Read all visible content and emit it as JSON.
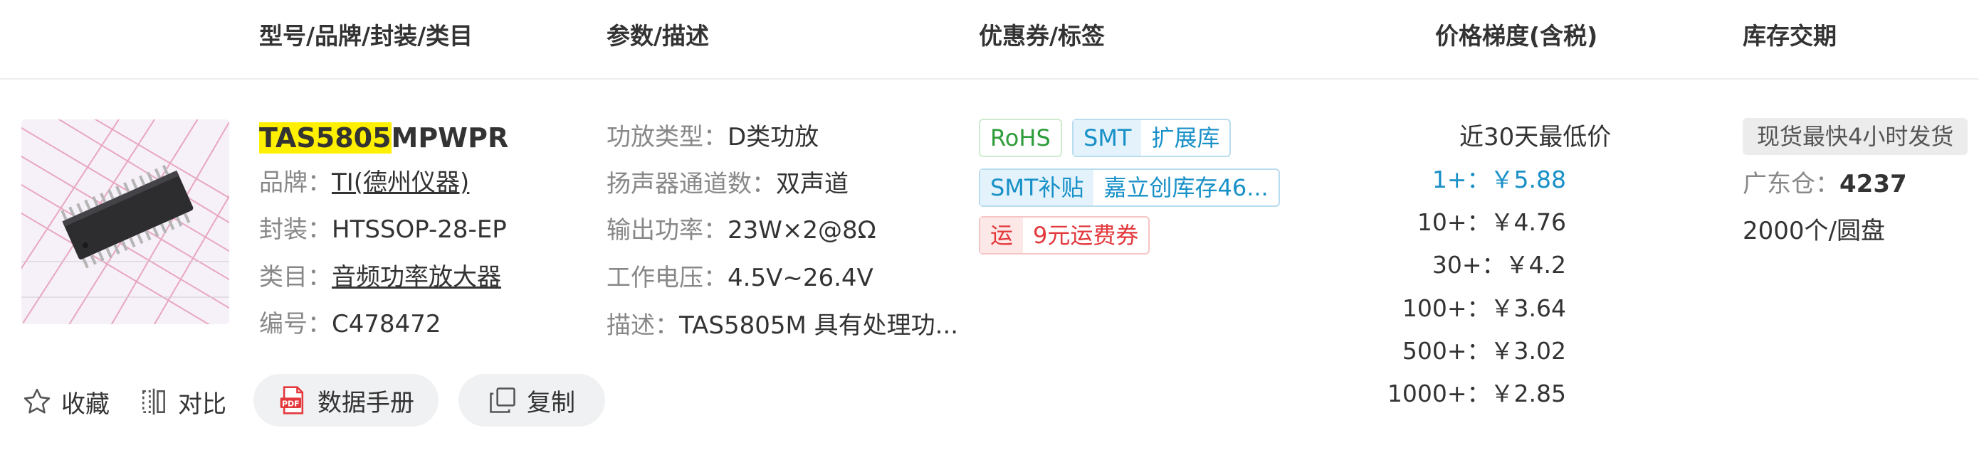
{
  "header": {
    "col_model": "型号/品牌/封装/类目",
    "col_params": "参数/描述",
    "col_coupon": "优惠券/标签",
    "col_price": "价格梯度(含税)",
    "col_stock": "库存交期"
  },
  "product": {
    "part_highlight": "TAS5805",
    "part_rest": "MPWPR",
    "brand_label": "品牌：",
    "brand_value": "TI(德州仪器)",
    "package_label": "封装：",
    "package_value": "HTSSOP-28-EP",
    "category_label": "类目：",
    "category_value": "音频功率放大器",
    "code_label": "编号：",
    "code_value": "C478472"
  },
  "params": [
    {
      "label": "功放类型：",
      "value": "D类功放"
    },
    {
      "label": "扬声器通道数：",
      "value": "双声道"
    },
    {
      "label": "输出功率：",
      "value": "23W×2@8Ω"
    },
    {
      "label": "工作电压：",
      "value": "4.5V~26.4V"
    },
    {
      "label": "描述：",
      "value": "TAS5805M 具有处理功..."
    }
  ],
  "tags": {
    "rohs": "RoHS",
    "smt": "SMT",
    "smt_ext": "扩展库",
    "smt_patch": "SMT补贴",
    "smt_stock": "嘉立创库存46...",
    "ship_icon": "运",
    "ship_coupon": "9元运费券"
  },
  "pricing": {
    "title": "近30天最低价",
    "tiers": [
      {
        "qty": "1+：",
        "price": "￥5.88"
      },
      {
        "qty": "10+：",
        "price": "￥4.76"
      },
      {
        "qty": "30+：",
        "price": "￥4.2"
      },
      {
        "qty": "100+：",
        "price": "￥3.64"
      },
      {
        "qty": "500+：",
        "price": "￥3.02"
      },
      {
        "qty": "1000+：",
        "price": "￥2.85"
      }
    ]
  },
  "stock": {
    "badge": "现货最快4小时发货",
    "warehouse_label": "广东仓：",
    "warehouse_qty": "4237",
    "packaging": "2000个/圆盘"
  },
  "actions": {
    "favorite": "收藏",
    "compare": "对比",
    "datasheet": "数据手册",
    "copy": "复制",
    "pdf_icon_text": "PDF"
  },
  "colors": {
    "highlight": "#ffef00",
    "link_blue": "#1890c8",
    "rohs_green": "#2e9d3a",
    "ship_red": "#e3383c"
  },
  "icons": {
    "favorite": "star-icon",
    "compare": "compare-icon",
    "datasheet": "pdf-icon",
    "copy": "copy-icon"
  }
}
